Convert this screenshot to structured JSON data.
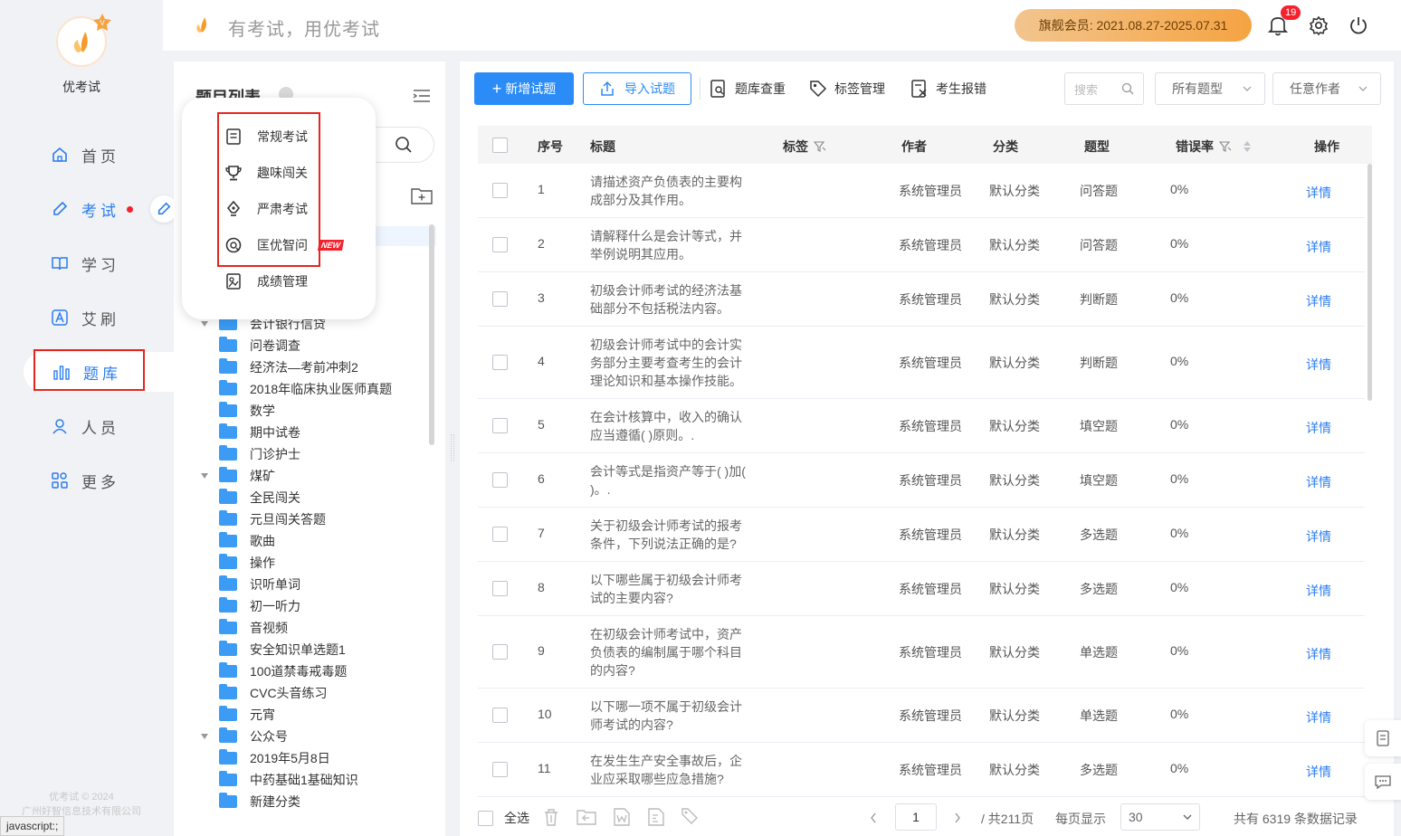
{
  "app": {
    "name": "优考试",
    "slogan": "有考试，用优考试"
  },
  "sidebar": {
    "items": [
      {
        "label": "首页",
        "icon": "home-icon"
      },
      {
        "label": "考试",
        "icon": "exam-icon"
      },
      {
        "label": "学习",
        "icon": "book-icon"
      },
      {
        "label": "艾刷",
        "icon": "a-icon"
      },
      {
        "label": "题库",
        "icon": "chart-icon"
      },
      {
        "label": "人员",
        "icon": "user-icon"
      },
      {
        "label": "更多",
        "icon": "grid-icon"
      }
    ],
    "copyright": "优考试 © 2024",
    "company": "广州好智信息技术有限公司"
  },
  "header": {
    "vip_text": "旗舰会员: 2021.08.27-2025.07.31",
    "notification_count": "19"
  },
  "popup_menu": {
    "items": [
      {
        "label": "常规考试",
        "icon": "document-icon"
      },
      {
        "label": "趣味闯关",
        "icon": "trophy-icon"
      },
      {
        "label": "严肃考试",
        "icon": "pen-icon"
      },
      {
        "label": "匡优智问",
        "icon": "ai-chat-icon",
        "badge": "NEW"
      },
      {
        "label": "成绩管理",
        "icon": "score-icon"
      }
    ]
  },
  "tree": {
    "title": "题目列表",
    "folders": [
      {
        "label": "会计银行信贷",
        "expanded": true
      },
      {
        "label": "问卷调查"
      },
      {
        "label": "经济法—考前冲刺2"
      },
      {
        "label": "2018年临床执业医师真题"
      },
      {
        "label": "数学"
      },
      {
        "label": "期中试卷"
      },
      {
        "label": "门诊护士"
      },
      {
        "label": "煤矿",
        "expanded": true
      },
      {
        "label": "全民闯关"
      },
      {
        "label": "元旦闯关答题"
      },
      {
        "label": "歌曲"
      },
      {
        "label": "操作"
      },
      {
        "label": "识听单词"
      },
      {
        "label": "初一听力"
      },
      {
        "label": "音视频"
      },
      {
        "label": "安全知识单选题1"
      },
      {
        "label": "100道禁毒戒毒题"
      },
      {
        "label": "CVC头音练习"
      },
      {
        "label": "元宵"
      },
      {
        "label": "公众号",
        "expanded": true
      },
      {
        "label": "2019年5月8日"
      },
      {
        "label": "中药基础1基础知识"
      },
      {
        "label": "新建分类"
      }
    ]
  },
  "toolbar": {
    "add_label": "新增试题",
    "import_label": "导入试题",
    "dedupe_label": "题库查重",
    "tags_label": "标签管理",
    "report_label": "考生报错",
    "search_placeholder": "搜索",
    "type_select": "所有题型",
    "author_select": "任意作者"
  },
  "table": {
    "headers": {
      "index": "序号",
      "title": "标题",
      "tag": "标签",
      "author": "作者",
      "category": "分类",
      "type": "题型",
      "error_rate": "错误率",
      "action": "操作"
    },
    "rows": [
      {
        "index": "1",
        "title": [
          "请描述资产负债表的主要构",
          "成部分及其作用。"
        ],
        "author": "系统管理员",
        "category": "默认分类",
        "type": "问答题",
        "error_rate": "0%",
        "action": "详情"
      },
      {
        "index": "2",
        "title": [
          "请解释什么是会计等式，并",
          "举例说明其应用。"
        ],
        "author": "系统管理员",
        "category": "默认分类",
        "type": "问答题",
        "error_rate": "0%",
        "action": "详情"
      },
      {
        "index": "3",
        "title": [
          "初级会计师考试的经济法基",
          "础部分不包括税法内容。"
        ],
        "author": "系统管理员",
        "category": "默认分类",
        "type": "判断题",
        "error_rate": "0%",
        "action": "详情"
      },
      {
        "index": "4",
        "title": [
          "初级会计师考试中的会计实",
          "务部分主要考查考生的会计",
          "理论知识和基本操作技能。"
        ],
        "author": "系统管理员",
        "category": "默认分类",
        "type": "判断题",
        "error_rate": "0%",
        "action": "详情"
      },
      {
        "index": "5",
        "title": [
          "在会计核算中，收入的确认",
          "应当遵循(   )原则。."
        ],
        "author": "系统管理员",
        "category": "默认分类",
        "type": "填空题",
        "error_rate": "0%",
        "action": "详情"
      },
      {
        "index": "6",
        "title": [
          "会计等式是指资产等于(    )加(",
          "    )。."
        ],
        "author": "系统管理员",
        "category": "默认分类",
        "type": "填空题",
        "error_rate": "0%",
        "action": "详情"
      },
      {
        "index": "7",
        "title": [
          "关于初级会计师考试的报考",
          "条件，下列说法正确的是?"
        ],
        "author": "系统管理员",
        "category": "默认分类",
        "type": "多选题",
        "error_rate": "0%",
        "action": "详情"
      },
      {
        "index": "8",
        "title": [
          "以下哪些属于初级会计师考",
          "试的主要内容?"
        ],
        "author": "系统管理员",
        "category": "默认分类",
        "type": "多选题",
        "error_rate": "0%",
        "action": "详情"
      },
      {
        "index": "9",
        "title": [
          "在初级会计师考试中，资产",
          "负债表的编制属于哪个科目",
          "的内容?"
        ],
        "author": "系统管理员",
        "category": "默认分类",
        "type": "单选题",
        "error_rate": "0%",
        "action": "详情"
      },
      {
        "index": "10",
        "title": [
          "以下哪一项不属于初级会计",
          "师考试的内容?"
        ],
        "author": "系统管理员",
        "category": "默认分类",
        "type": "单选题",
        "error_rate": "0%",
        "action": "详情"
      },
      {
        "index": "11",
        "title": [
          "在发生生产安全事故后，企",
          "业应采取哪些应急措施?"
        ],
        "author": "系统管理员",
        "category": "默认分类",
        "type": "多选题",
        "error_rate": "0%",
        "action": "详情"
      }
    ]
  },
  "footer": {
    "select_all": "全选",
    "page_current": "1",
    "page_total": "/ 共211页",
    "page_size_label": "每页显示",
    "page_size": "30",
    "total_records": "共有 6319 条数据记录"
  },
  "statusbar": {
    "text": "javascript:;"
  },
  "colors": {
    "primary": "#2b7df0",
    "highlight": "#e5261f",
    "vip_start": "#f2c58e",
    "vip_end": "#f5a342"
  }
}
